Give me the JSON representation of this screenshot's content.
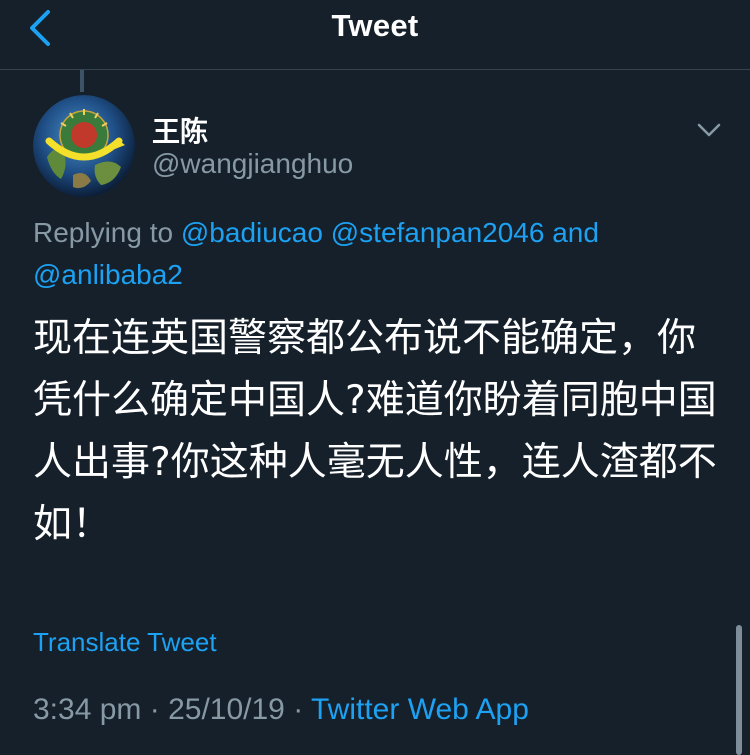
{
  "header": {
    "title": "Tweet",
    "back_icon": "chevron-left-icon"
  },
  "author": {
    "display_name": "王陈",
    "handle": "@wangjianghuo",
    "avatar_icon": "globe-logo-avatar"
  },
  "reply": {
    "prefix": "Replying to",
    "mentions": [
      "@badiucao",
      "@stefanpan2046"
    ],
    "connector": "and",
    "last_mention": "@anlibaba2"
  },
  "tweet": {
    "text": "现在连英国警察都公布说不能确定，你凭什么确定中国人?难道你盼着同胞中国人出事?你这种人毫无人性，连人渣都不如！",
    "translate_label": "Translate Tweet"
  },
  "meta": {
    "time": "3:34 pm",
    "separator": "·",
    "date": "25/10/19",
    "source": "Twitter Web App"
  },
  "colors": {
    "background": "#15202b",
    "accent": "#1da1f2",
    "secondary_text": "#8899a6",
    "divider": "#38444d"
  }
}
